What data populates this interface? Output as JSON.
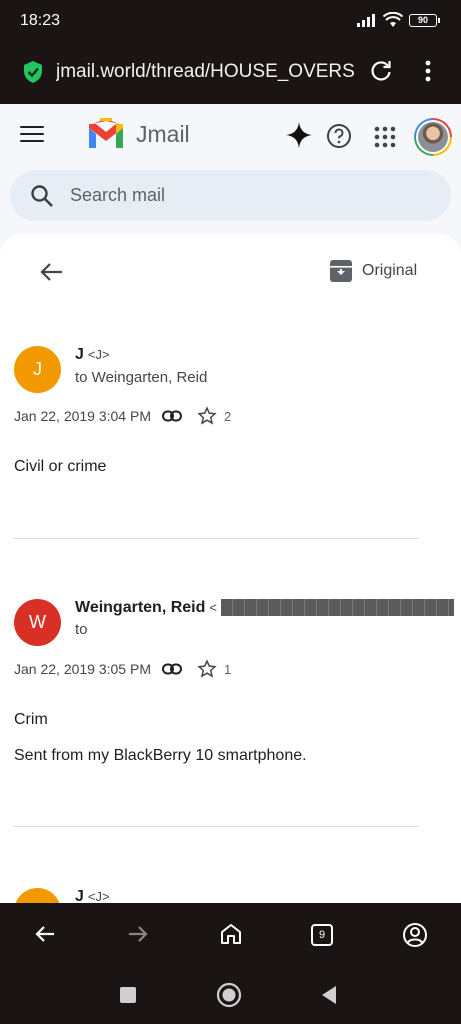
{
  "status": {
    "time": "18:23",
    "battery": "90"
  },
  "browser": {
    "url": "jmail.world/thread/HOUSE_OVERS",
    "tab_count": "9"
  },
  "app": {
    "name": "Jmail",
    "search_placeholder": "Search mail",
    "original_label": "Original"
  },
  "messages": [
    {
      "avatar_letter": "J",
      "avatar_color": "#f29900",
      "sender": "J",
      "sender_addr": "<J>",
      "to": "to Weingarten, Reid",
      "date": "Jan 22, 2019 3:04 PM",
      "star_count": "2",
      "body": [
        "Civil or crime"
      ]
    },
    {
      "avatar_letter": "W",
      "avatar_color": "#d93025",
      "sender": "Weingarten, Reid",
      "sender_addr": "<",
      "to": "to",
      "date": "Jan 22, 2019 3:05 PM",
      "star_count": "1",
      "body": [
        "Crim",
        "Sent from my BlackBerry 10 smartphone."
      ]
    },
    {
      "avatar_letter": "J",
      "avatar_color": "#f29900",
      "sender": "J",
      "sender_addr": "<J>"
    }
  ]
}
